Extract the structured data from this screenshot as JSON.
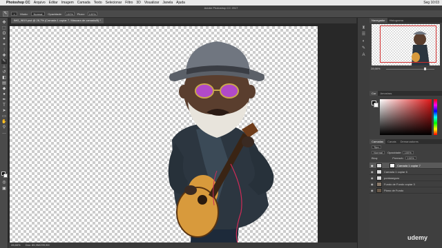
{
  "menubar": {
    "apple": "",
    "app": "Photoshop CC",
    "items": [
      "Arquivo",
      "Editar",
      "Imagem",
      "Camada",
      "Texto",
      "Selecionar",
      "Filtro",
      "3D",
      "Visualizar",
      "Janela",
      "Ajuda"
    ],
    "clock": "Seg 10:03"
  },
  "titlebar": {
    "title": "Adobe Photoshop CC 2017"
  },
  "options": {
    "modo_label": "Modo:",
    "modo_value": "Normal",
    "opacidade_label": "Opacidade:",
    "opacidade_value": "100%",
    "fluxo_label": "Fluxo:",
    "fluxo_value": "100%"
  },
  "document": {
    "tab_label": "IMG_9819.psd @ 28,7% (Camada 1 copiar 7, Máscara de camada/8) *",
    "status_zoom": "28,66%",
    "status_doc": "Doc: 85,9M/299,9M"
  },
  "navigator": {
    "tabs": [
      "Navegador",
      "Histograma"
    ],
    "zoom": "28,66%"
  },
  "color_panel": {
    "tabs": [
      "Cor",
      "Amostras"
    ]
  },
  "layers_panel": {
    "tabs": [
      "Camadas",
      "Canais",
      "Demarcadores"
    ],
    "kind": "Tipo",
    "blend": "Normal",
    "opacity_label": "Opacidade:",
    "opacity": "100%",
    "lock_label": "Bloq:",
    "fill_label": "Preench.:",
    "fill": "100%",
    "layers": [
      {
        "name": "Camada 1 copiar 7",
        "active": true,
        "mask": true
      },
      {
        "name": "Camada 1 copiar 6",
        "active": false,
        "mask": false
      },
      {
        "name": "pontoseguro",
        "active": false,
        "mask": false
      },
      {
        "name": "Fundo de Fundo copiar 3",
        "active": false,
        "mask": false
      },
      {
        "name": "Plano de Fundo",
        "active": false,
        "mask": false
      }
    ]
  },
  "watermark": "udemy",
  "colors": {
    "accent_red": "#d12b2b",
    "canvas_dark": "#282828",
    "panel": "#3f3f3f"
  }
}
